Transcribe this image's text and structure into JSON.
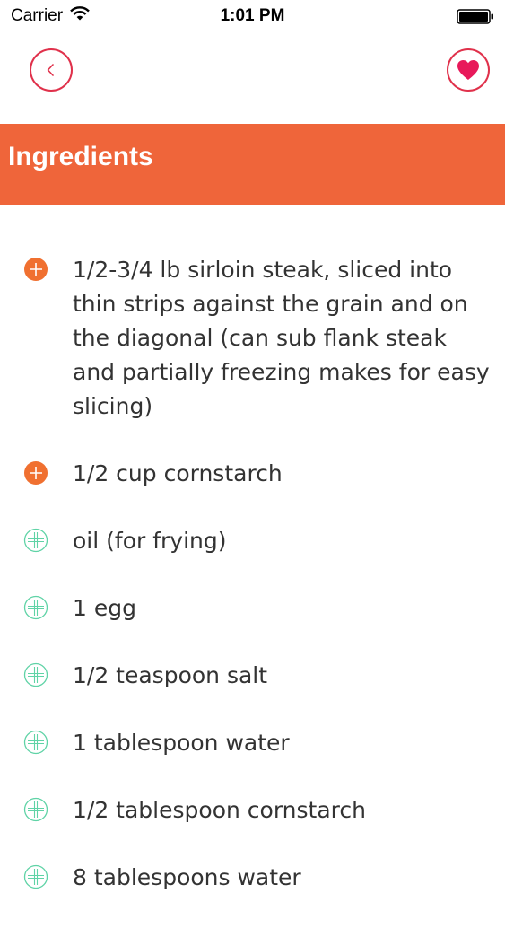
{
  "status_bar": {
    "carrier": "Carrier",
    "time": "1:01 PM",
    "wifi_icon": "wifi-icon",
    "battery_icon": "battery-full-icon"
  },
  "nav": {
    "back_icon": "chevron-left-icon",
    "favorite_icon": "heart-icon",
    "accent_color": "#e0314b"
  },
  "section": {
    "title": "Ingredients",
    "header_color": "#ef653a"
  },
  "ingredients": [
    {
      "text": "1/2-3/4 lb sirloin steak, sliced into thin strips against the grain and on the diagonal (can sub flank steak and partially freezing makes for easy slicing)",
      "added": true
    },
    {
      "text": "1/2 cup cornstarch",
      "added": true
    },
    {
      "text": "oil (for frying)",
      "added": false
    },
    {
      "text": "1 egg",
      "added": false
    },
    {
      "text": "1/2 teaspoon salt",
      "added": false
    },
    {
      "text": "1 tablespoon water",
      "added": false
    },
    {
      "text": "1/2 tablespoon cornstarch",
      "added": false
    },
    {
      "text": "8 tablespoons water",
      "added": false
    }
  ],
  "icon_colors": {
    "added": "#f07030",
    "not_added": "#5fd3a6"
  }
}
